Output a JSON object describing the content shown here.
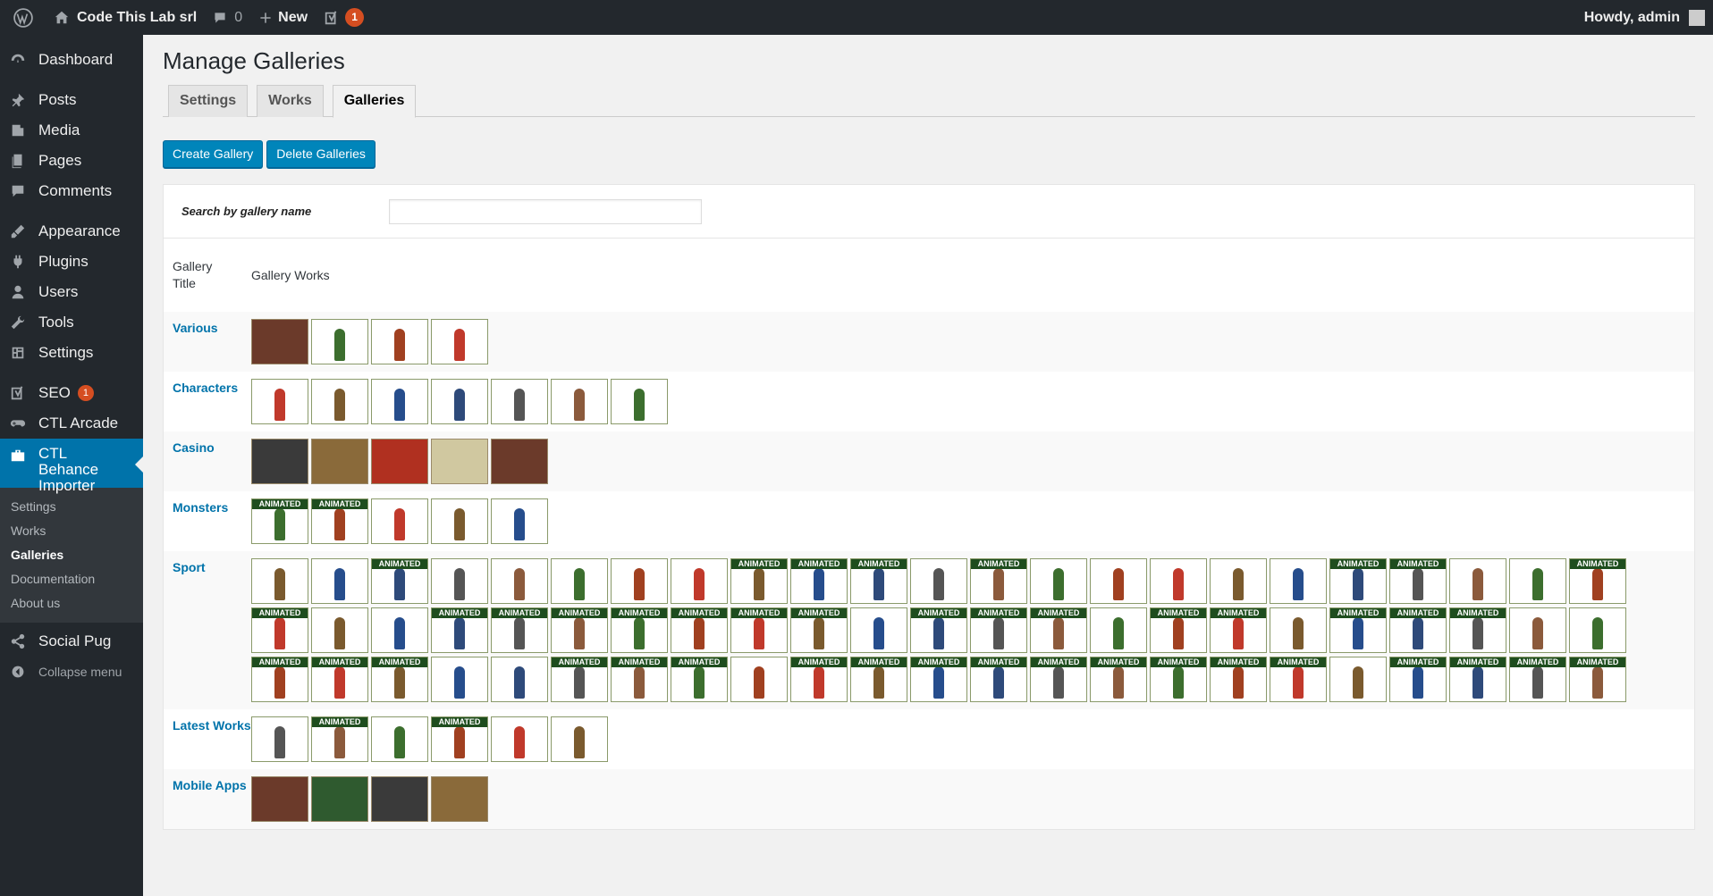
{
  "admin_bar": {
    "site_name": "Code This Lab srl",
    "comments_count": "0",
    "new_label": "New",
    "seo_badge": "1",
    "greeting": "Howdy, admin"
  },
  "sidebar": {
    "items": [
      {
        "label": "Dashboard",
        "icon": "dashboard-icon"
      },
      {
        "label": "Posts",
        "icon": "pin-icon"
      },
      {
        "label": "Media",
        "icon": "media-icon"
      },
      {
        "label": "Pages",
        "icon": "pages-icon"
      },
      {
        "label": "Comments",
        "icon": "comment-icon"
      },
      {
        "label": "Appearance",
        "icon": "brush-icon"
      },
      {
        "label": "Plugins",
        "icon": "plug-icon"
      },
      {
        "label": "Users",
        "icon": "user-icon"
      },
      {
        "label": "Tools",
        "icon": "wrench-icon"
      },
      {
        "label": "Settings",
        "icon": "settings-icon"
      },
      {
        "label": "SEO",
        "icon": "seo-icon",
        "badge": "1"
      },
      {
        "label": "CTL Arcade",
        "icon": "gamepad-icon"
      },
      {
        "label": "CTL Behance Importer",
        "icon": "briefcase-icon"
      }
    ],
    "submenu": [
      "Settings",
      "Works",
      "Galleries",
      "Documentation",
      "About us"
    ],
    "social_pug": "Social Pug",
    "collapse": "Collapse menu"
  },
  "page": {
    "title": "Manage Galleries",
    "tabs": [
      "Settings",
      "Works",
      "Galleries"
    ],
    "active_tab": "Galleries",
    "create_button": "Create Gallery",
    "delete_button": "Delete Galleries",
    "search_label": "Search by gallery name",
    "search_value": "",
    "col_title": "Gallery Title",
    "col_works": "Gallery Works"
  },
  "colors": {
    "accent": "#0073aa",
    "button": "#0085ba",
    "badge": "#d54e21",
    "menu_bg": "#23282d",
    "banner_green": "#1e4d1e"
  },
  "galleries": [
    {
      "name": "Various",
      "count": 4,
      "animated": []
    },
    {
      "name": "Characters",
      "count": 7,
      "animated": []
    },
    {
      "name": "Casino",
      "count": 5,
      "animated": []
    },
    {
      "name": "Monsters",
      "count": 5,
      "animated": [
        0,
        1
      ]
    },
    {
      "name": "Sport",
      "count": 69,
      "animated": [
        2,
        8,
        9,
        10,
        12,
        18,
        19,
        22,
        23,
        26,
        27,
        28,
        29,
        30,
        31,
        32,
        34,
        35,
        36,
        38,
        39,
        41,
        42,
        43,
        46,
        47,
        48,
        51,
        52,
        53,
        55,
        56,
        57,
        58,
        59,
        60,
        61,
        62,
        63,
        65,
        66,
        67,
        68
      ]
    },
    {
      "name": "Latest Works",
      "count": 6,
      "animated": [
        1,
        3
      ]
    },
    {
      "name": "Mobile Apps",
      "count": 4,
      "animated": []
    }
  ],
  "banner_text": "ANIMATED"
}
